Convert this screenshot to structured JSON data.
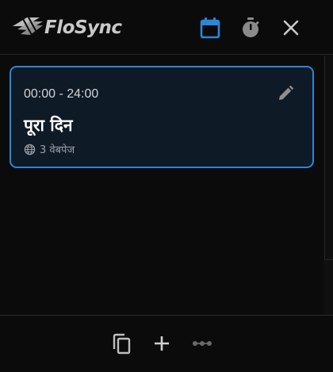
{
  "app": {
    "brand": "FloSync",
    "accent_color": "#2a86d9"
  },
  "header": {
    "icons": [
      "calendar-icon",
      "timer-icon",
      "close-icon"
    ]
  },
  "schedule": {
    "items": [
      {
        "time_range": "00:00 - 24:00",
        "title": "पूरा दिन",
        "websites_label": "3 वेबपेज"
      }
    ]
  },
  "footer": {
    "icons": [
      "copy-icon",
      "add-icon",
      "more-icon"
    ]
  }
}
